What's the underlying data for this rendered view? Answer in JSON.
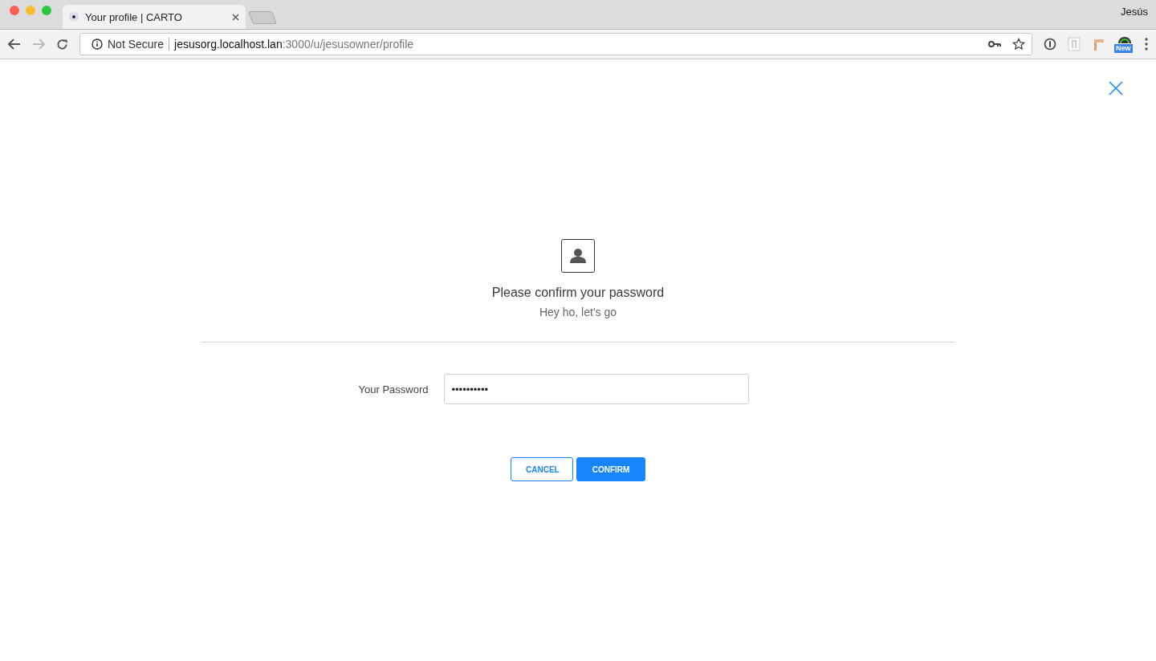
{
  "browser": {
    "tab_title": "Your profile | CARTO",
    "profile_name": "Jesús",
    "security": "Not Secure",
    "url_host": "jesusorg.localhost.lan",
    "url_path": ":3000/u/jesusowner/profile",
    "extension_badge": "New"
  },
  "dialog": {
    "title": "Please confirm your password",
    "subtitle": "Hey ho, let's go",
    "field": {
      "label": "Your Password",
      "value": "••••••••••"
    },
    "buttons": [
      {
        "label": "CANCEL",
        "kind": "secondary"
      },
      {
        "label": "CONFIRM",
        "kind": "primary"
      }
    ]
  }
}
